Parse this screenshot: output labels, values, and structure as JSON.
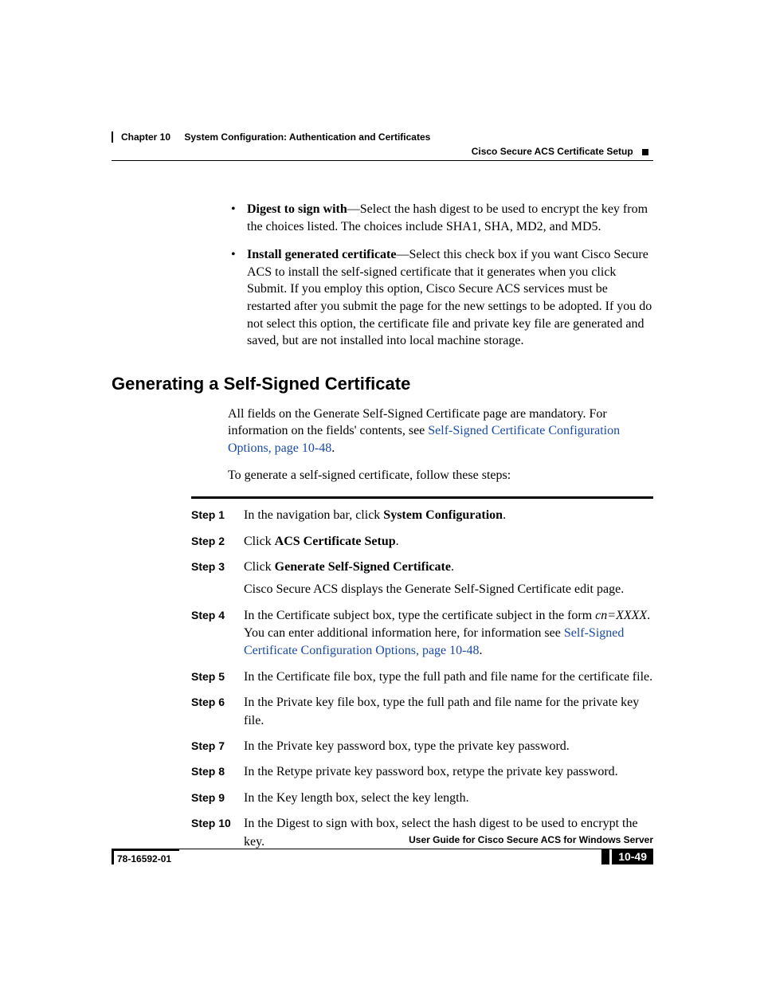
{
  "header": {
    "chapter_label": "Chapter 10",
    "chapter_title": "System Configuration: Authentication and Certificates",
    "section_title": "Cisco Secure ACS Certificate Setup"
  },
  "bullets": [
    {
      "term": "Digest to sign with",
      "text": "—Select the hash digest to be used to encrypt the key from the choices listed. The choices include SHA1, SHA, MD2, and MD5."
    },
    {
      "term": "Install generated certificate",
      "text": "—Select this check box if you want Cisco Secure ACS to install the self-signed certificate that it generates when you click Submit. If you employ this option, Cisco Secure ACS services must be restarted after you submit the page for the new settings to be adopted. If you do not select this option, the certificate file and private key file are generated and saved, but are not installed into local machine storage."
    }
  ],
  "section_heading": "Generating a Self-Signed Certificate",
  "intro": {
    "pre": "All fields on the Generate Self-Signed Certificate page are mandatory. For information on the fields' contents, see ",
    "link": "Self-Signed Certificate Configuration Options, page 10-48",
    "post": "."
  },
  "intro2": "To generate a self-signed certificate, follow these steps:",
  "steps": [
    {
      "label": "Step 1",
      "parts": [
        {
          "t": "In the navigation bar, click "
        },
        {
          "t": "System Configuration",
          "b": true
        },
        {
          "t": "."
        }
      ]
    },
    {
      "label": "Step 2",
      "parts": [
        {
          "t": "Click "
        },
        {
          "t": "ACS Certificate Setup",
          "b": true
        },
        {
          "t": "."
        }
      ]
    },
    {
      "label": "Step 3",
      "parts": [
        {
          "t": "Click "
        },
        {
          "t": "Generate Self-Signed Certificate",
          "b": true
        },
        {
          "t": "."
        }
      ],
      "sub": "Cisco Secure ACS displays the Generate Self-Signed Certificate edit page."
    },
    {
      "label": "Step 4",
      "parts": [
        {
          "t": "In the Certificate subject box, type the certificate subject in the form "
        },
        {
          "t": "cn=XXXX",
          "i": true
        },
        {
          "t": ". You can enter additional information here, for information see "
        },
        {
          "t": "Self-Signed Certificate Configuration Options, page 10-48",
          "link": true
        },
        {
          "t": "."
        }
      ]
    },
    {
      "label": "Step 5",
      "parts": [
        {
          "t": "In the Certificate file box, type the full path and file name for the certificate file."
        }
      ]
    },
    {
      "label": "Step 6",
      "parts": [
        {
          "t": "In the Private key file box, type the full path and file name for the private key file."
        }
      ]
    },
    {
      "label": "Step 7",
      "parts": [
        {
          "t": "In the Private key password box, type the private key password."
        }
      ]
    },
    {
      "label": "Step 8",
      "parts": [
        {
          "t": "In the Retype private key password box, retype the private key password."
        }
      ]
    },
    {
      "label": "Step 9",
      "parts": [
        {
          "t": "In the Key length box, select the key length."
        }
      ]
    },
    {
      "label": "Step 10",
      "parts": [
        {
          "t": "In the Digest to sign with box, select the hash digest to be used to encrypt the key."
        }
      ]
    }
  ],
  "footer": {
    "title": "User Guide for Cisco Secure ACS for Windows Server",
    "doc_id": "78-16592-01",
    "page": "10-49"
  }
}
